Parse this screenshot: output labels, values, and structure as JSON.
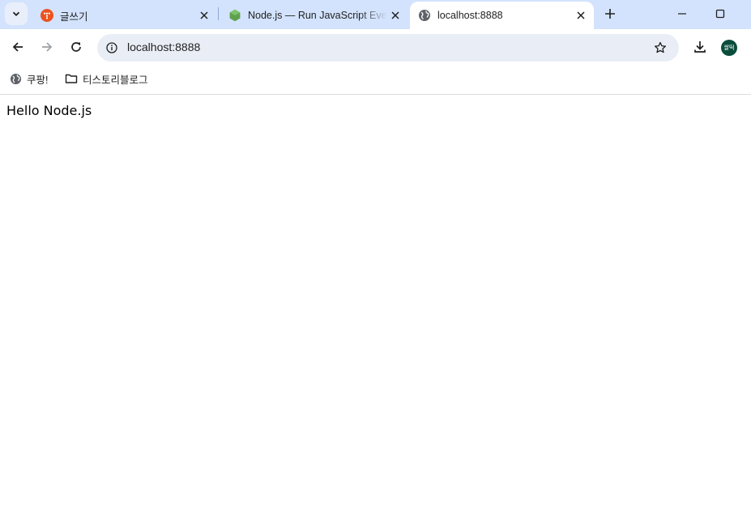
{
  "browser": {
    "tabs": [
      {
        "title": "글쓰기",
        "favicon": "tistory-icon",
        "active": false
      },
      {
        "title": "Node.js — Run JavaScript Eve",
        "favicon": "nodejs-icon",
        "active": false
      },
      {
        "title": "localhost:8888",
        "favicon": "globe-icon",
        "active": true
      }
    ],
    "address": {
      "url": "localhost:8888"
    },
    "profile": {
      "avatar_text": "쌀떡"
    },
    "bookmarks": [
      {
        "label": "쿠팡!",
        "icon": "globe-icon"
      },
      {
        "label": "티스토리블로그",
        "icon": "folder-icon"
      }
    ]
  },
  "page": {
    "text": "Hello Node.js"
  },
  "colors": {
    "tabstrip": "#d3e3fd",
    "omnibox": "#e9eef6",
    "tistory_orange": "#eb531f",
    "nodejs_green": "#5fa04e",
    "avatar_bg": "#0b4d3c"
  }
}
